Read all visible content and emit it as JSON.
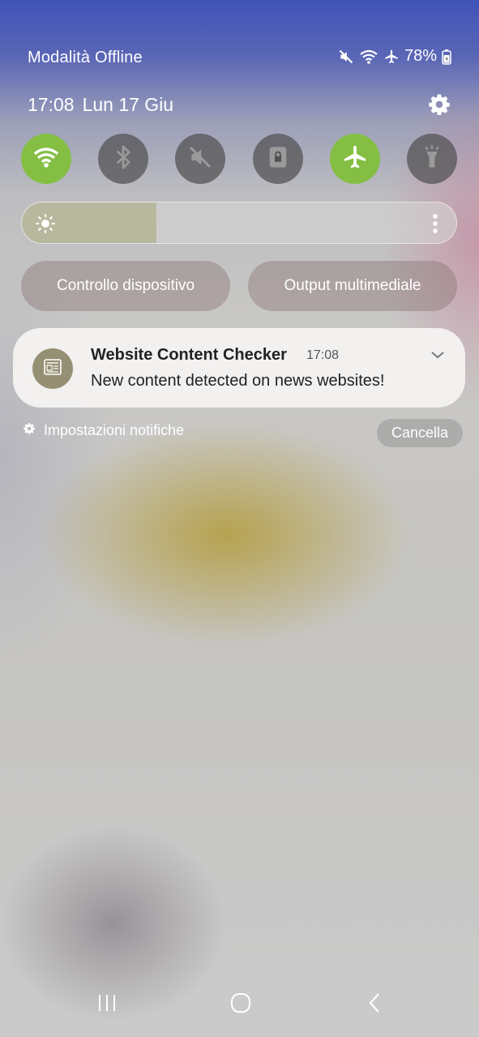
{
  "status_bar": {
    "carrier": "Modalità Offline",
    "battery_percent": "78%",
    "icons": [
      "mute-icon",
      "wifi-icon",
      "airplane-icon",
      "battery-icon"
    ]
  },
  "header": {
    "time": "17:08",
    "date": "Lun 17 Giu"
  },
  "quick_toggles": [
    {
      "name": "wifi",
      "icon": "wifi-icon",
      "on": true
    },
    {
      "name": "bluetooth",
      "icon": "bluetooth-icon",
      "on": false
    },
    {
      "name": "sound",
      "icon": "mute-icon",
      "on": false
    },
    {
      "name": "rotation-lock",
      "icon": "lock-icon",
      "on": false
    },
    {
      "name": "airplane",
      "icon": "airplane-icon",
      "on": true
    },
    {
      "name": "flashlight",
      "icon": "flashlight-icon",
      "on": false
    }
  ],
  "brightness": {
    "level": 0.31
  },
  "buttons": {
    "device_control": "Controllo dispositivo",
    "media_output": "Output multimediale"
  },
  "notification": {
    "app_name": "Website Content Checker",
    "time": "17:08",
    "message": "New content detected on news websites!"
  },
  "notification_footer": {
    "settings_label": "Impostazioni notifiche",
    "clear_label": "Cancella"
  },
  "colors": {
    "toggle_on": "#84bf44",
    "toggle_off": "#505050",
    "app_icon": "#959074"
  }
}
